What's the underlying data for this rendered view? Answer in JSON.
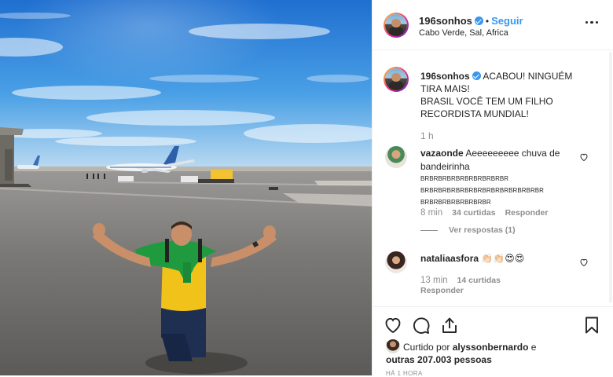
{
  "post": {
    "username": "196sonhos",
    "follow_label": "Seguir",
    "separator": "•",
    "location": "Cabo Verde, Sal, Africa"
  },
  "caption": {
    "username": "196sonhos",
    "text_line1": "ACABOU! NINGUÉM",
    "text_line2": "TIRA MAIS!",
    "text_line3": "BRASIL VOCÊ TEM UM FILHO",
    "text_line4": "RECORDISTA MUNDIAL!",
    "time": "1 h"
  },
  "comments": [
    {
      "username": "vazaonde",
      "text": "Aeeeeeeeee chuva de bandeirinha",
      "spam_line1": "BRBRBRBRBRBRBRBRBRBR",
      "spam_line2": "BRBRBRBRBRBRBRBRBRBRBRBRBRBR",
      "spam_line3": "BRBRBRBRBRBRBRBR",
      "time": "8 min",
      "likes": "34 curtidas",
      "reply": "Responder",
      "view_replies": "Ver respostas (1)"
    },
    {
      "username": "nataliaasfora",
      "text": "👏🏻👏🏻😍😍",
      "time": "13 min",
      "likes": "14 curtidas",
      "reply": "Responder"
    }
  ],
  "liked_by": {
    "prefix": "Curtido por",
    "user": "alyssonbernardo",
    "conj": "e",
    "others": "outras 207.003 pessoas"
  },
  "posted_ago": "HÁ 1 HORA",
  "icons": {
    "more": "more-options-icon",
    "like": "heart-icon",
    "comment": "comment-icon",
    "share": "share-icon",
    "save": "bookmark-icon",
    "verified": "verified-badge-icon"
  },
  "colors": {
    "accent": "#3897f0",
    "muted": "#8e8e8e",
    "text": "#262626",
    "border": "#efefef"
  }
}
